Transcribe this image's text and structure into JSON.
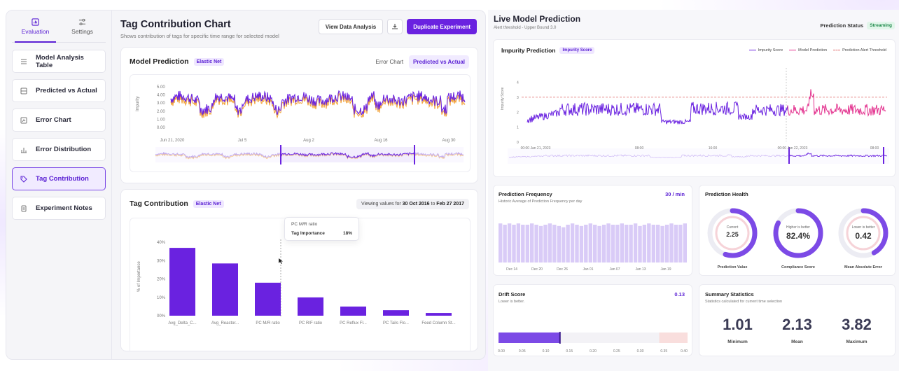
{
  "colors": {
    "accent": "#6a22e0",
    "series_a": "#6a22e0",
    "series_b": "#f2a33a",
    "prediction": "#e3338f",
    "threshold": "#e06b6b",
    "badge_green": "#1f8a4c"
  },
  "sidebar": {
    "tabs": [
      {
        "label": "Evaluation",
        "icon": "bar-chart-icon",
        "active": true
      },
      {
        "label": "Settings",
        "icon": "sliders-icon",
        "active": false
      }
    ],
    "items": [
      {
        "label": "Model Analysis Table",
        "icon": "list-icon",
        "active": false
      },
      {
        "label": "Predicted vs Actual",
        "icon": "compare-icon",
        "active": false
      },
      {
        "label": "Error Chart",
        "icon": "chart-icon",
        "active": false
      },
      {
        "label": "Error Distribution",
        "icon": "distribution-icon",
        "active": false
      },
      {
        "label": "Tag Contribution",
        "icon": "tag-icon",
        "active": true
      },
      {
        "label": "Experiment Notes",
        "icon": "notes-icon",
        "active": false
      }
    ]
  },
  "header": {
    "title": "Tag Contribution Chart",
    "subtitle": "Shows contribution of tags for specific time range for selected model",
    "view_btn": "View Data Analysis",
    "duplicate_btn": "Duplicate Experiment"
  },
  "model_prediction": {
    "title": "Model Prediction",
    "pill": "Elastic Net",
    "toggle": [
      "Error Chart",
      "Predicted vs Actual"
    ],
    "ylabel": "Impurity",
    "yticks": [
      "5.00",
      "4.00",
      "3.00",
      "2.00",
      "1.00",
      "0.00"
    ],
    "xticks": [
      "Jun 21, 2020",
      "Jul 5",
      "Aug 2",
      "Aug 16",
      "Aug 30"
    ]
  },
  "tag_contribution": {
    "title": "Tag Contribution",
    "pill": "Elastic Net",
    "range_prefix": "Viewing values for ",
    "range_from": "30 Oct 2016",
    "range_mid": " to ",
    "range_to": "Feb 27 2017",
    "tooltip": {
      "title": "PC M/R ratio",
      "label": "Tag Importance",
      "value": "18%"
    }
  },
  "chart_data": [
    {
      "type": "bar",
      "categories": [
        "Avg_Delta_C...",
        "Avg_Reactor...",
        "PC M/R ratio",
        "PC R/F ratio",
        "PC Reflux Fl...",
        "PC Tails Flo...",
        "Feed Column St..."
      ],
      "values": [
        37,
        28.5,
        18,
        10,
        5,
        3,
        1.5
      ],
      "ylabel": "% of Importance",
      "yticks": [
        "40%",
        "30%",
        "20%",
        "10%",
        "00%"
      ],
      "ylim": [
        0,
        42
      ]
    },
    {
      "type": "bar",
      "categories": [
        "Dec 14",
        "Dec 20",
        "Dec 26",
        "Jan 01",
        "Jan 07",
        "Jan 13",
        "Jan 19"
      ],
      "values": [
        31,
        30,
        31,
        30,
        31,
        30,
        30,
        31,
        30,
        29,
        30,
        31,
        30,
        29,
        28,
        30,
        31,
        30,
        29,
        30,
        31,
        30,
        29,
        30,
        31,
        30,
        30,
        31,
        30,
        30,
        31,
        29,
        30,
        31,
        30,
        30,
        29,
        30,
        31,
        30,
        30,
        31
      ],
      "ylim": [
        0,
        50
      ]
    },
    {
      "type": "line",
      "title": "Impurity Prediction",
      "series": [
        {
          "name": "Impurity Score"
        },
        {
          "name": "Model Prediction"
        },
        {
          "name": "Prediction Alert Threshold",
          "value": 3
        }
      ],
      "yticks": [
        "4",
        "3",
        "2",
        "1",
        "0"
      ],
      "ylim": [
        0,
        4.4
      ],
      "xticks": [
        "00:00 Jan 21, 2023",
        "08:00",
        "16:00",
        "00:00 Jan 22, 2023",
        "08:00"
      ]
    },
    {
      "type": "bar",
      "title": "Drift Score",
      "values": [
        0.13
      ],
      "xticks": [
        "0.00",
        "0.05",
        "0.10",
        "0.15",
        "0.20",
        "0.25",
        "0.30",
        "0.35",
        "0.40"
      ],
      "xlim": [
        0,
        0.4
      ],
      "alert_from": 0.34
    }
  ],
  "live": {
    "title": "Live Model Prediction",
    "subtitle": "Alert threshold - Upper Bound 3.0",
    "status_label": "Prediction Status",
    "status_badge": "Streaming",
    "impurity": {
      "title": "Impurity Prediction",
      "pill": "Impurity Score",
      "legend": [
        "Impurity Score",
        "Model Prediction",
        "Prediction Alert Threshold"
      ],
      "ylabel": "Impurity Score"
    },
    "frequency": {
      "title": "Prediction Frequency",
      "subtitle": "Historic Average of Prediction Frequency per day",
      "value": "30 / min"
    },
    "health": {
      "title": "Prediction Health",
      "gauges": [
        {
          "inner": "Current",
          "value": "2.25",
          "label": "Prediction Value",
          "fraction": 0.55
        },
        {
          "inner": "Higher is better",
          "value": "82.4%",
          "label": "Compliance Score",
          "fraction": 0.824
        },
        {
          "inner": "Lower is better",
          "value": "0.42",
          "label": "Mean Absolute Error",
          "fraction": 0.42
        }
      ]
    },
    "drift": {
      "title": "Drift Score",
      "subtitle": "Lower is better.",
      "value": "0.13"
    },
    "summary": {
      "title": "Summary Statistics",
      "subtitle": "Statistics calculated for current time selection",
      "stats": [
        {
          "value": "1.01",
          "label": "Minimum"
        },
        {
          "value": "2.13",
          "label": "Mean"
        },
        {
          "value": "3.82",
          "label": "Maximum"
        }
      ]
    }
  }
}
